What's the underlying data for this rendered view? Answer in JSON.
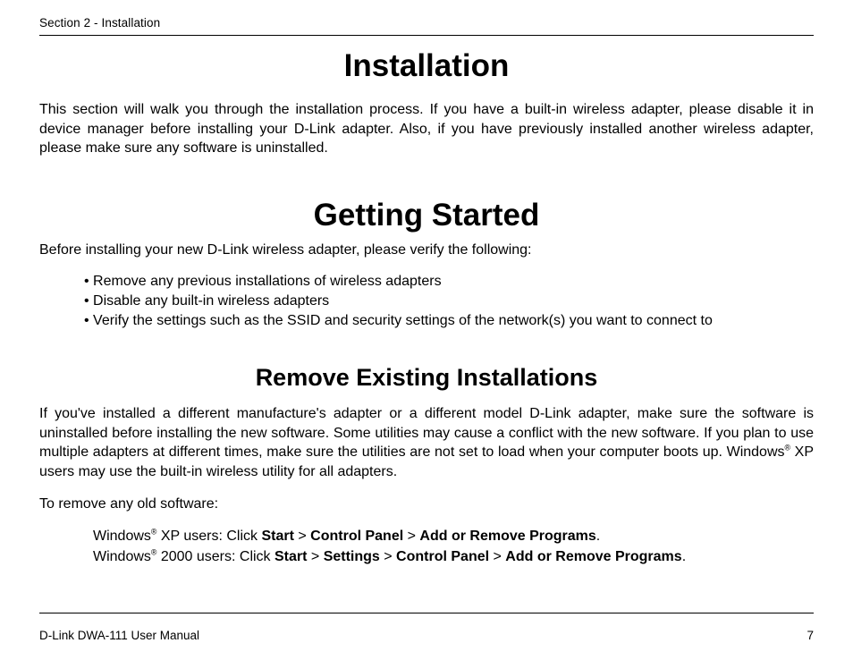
{
  "header": {
    "section_label": "Section 2 - Installation"
  },
  "titles": {
    "installation": "Installation",
    "getting_started": "Getting Started",
    "remove_existing": "Remove Existing Installations"
  },
  "paragraphs": {
    "intro": "This section will walk you through the installation process. If you have a built-in wireless adapter, please disable it in device manager before installing your D-Link adapter. Also, if you have previously installed another wireless adapter, please make sure any software is uninstalled.",
    "getting_started_intro": "Before installing your new D-Link wireless adapter, please verify the following:",
    "remove_existing_body_1": "If you've installed a different manufacture's adapter or a different model D-Link adapter, make sure the software is uninstalled before installing the new software. Some utilities may cause a conflict with the new software. If you plan to use multiple adapters at different times, make sure the utilities are not set to load when your computer boots up. Windows",
    "remove_existing_body_2": " XP users may use the built-in wireless utility for all adapters.",
    "to_remove": "To remove any old software:"
  },
  "bullets": [
    "Remove any previous installations of wireless adapters",
    "Disable any built-in wireless adapters",
    "Verify the settings such as the SSID and security settings of the network(s) you want to connect to"
  ],
  "instructions": {
    "xp": {
      "prefix": "Windows",
      "os": " XP users:  Click ",
      "steps": [
        "Start",
        "Control Panel",
        "Add or Remove Programs"
      ]
    },
    "win2000": {
      "prefix": "Windows",
      "os": " 2000 users: Click ",
      "steps": [
        "Start",
        "Settings",
        "Control Panel",
        "Add or Remove Programs"
      ]
    }
  },
  "footer": {
    "left": "D-Link DWA-111 User Manual",
    "right": "7"
  }
}
